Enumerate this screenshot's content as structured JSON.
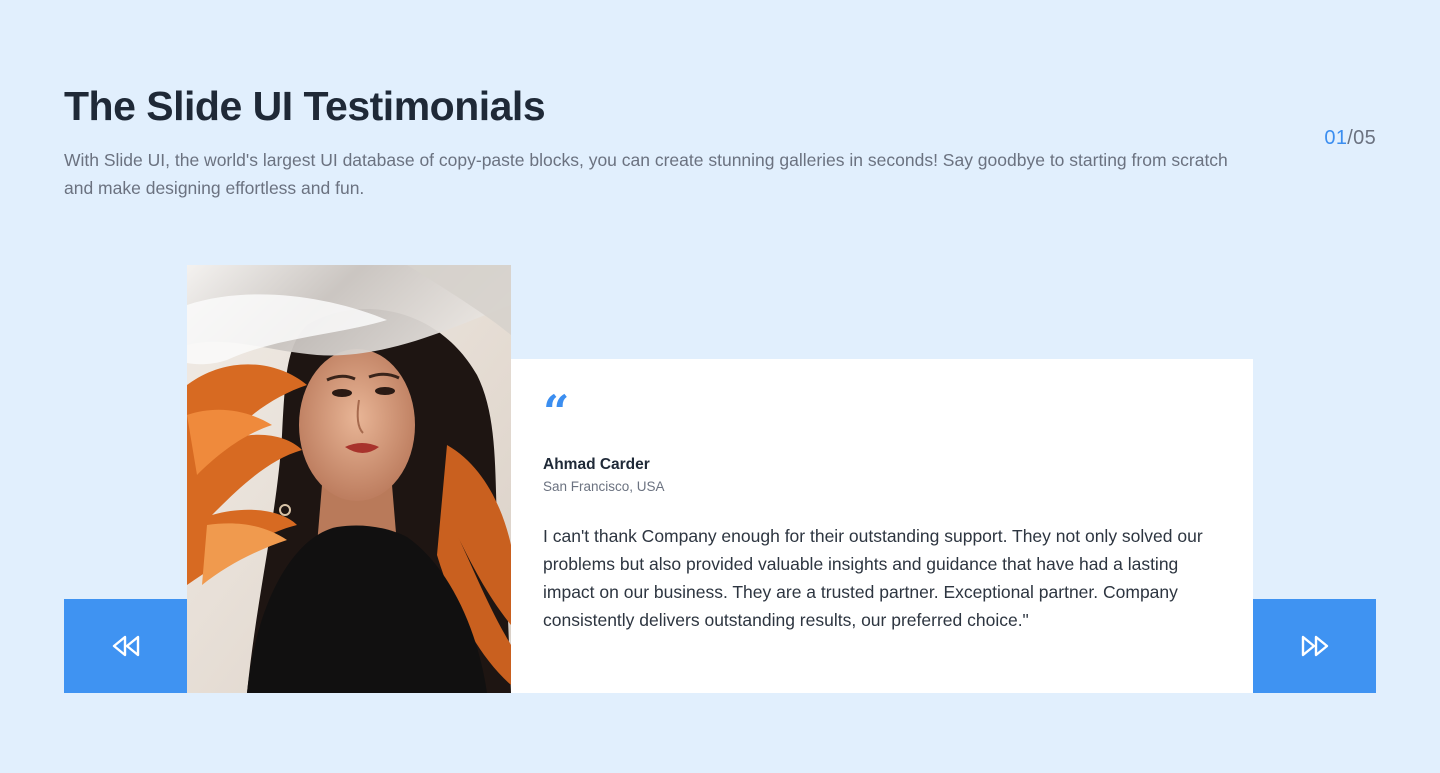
{
  "header": {
    "title": "The Slide UI Testimonials",
    "subtitle": "With Slide UI, the world's largest UI database of copy-paste blocks, you can create stunning galleries in seconds! Say goodbye to starting from scratch and make designing effortless and fun."
  },
  "pagination": {
    "current": "01",
    "separator": "/",
    "total": "05"
  },
  "testimonial": {
    "quote_icon": "quote-icon",
    "author_name": "Ahmad Carder",
    "author_location": "San Francisco, USA",
    "text": "I can't thank Company enough for their outstanding support. They not only solved our problems but also provided valuable insights and guidance that have had a lasting impact on our business. They are a trusted partner. Exceptional partner. Company consistently delivers outstanding results, our preferred choice.\""
  },
  "navigation": {
    "prev_icon": "rewind-icon",
    "next_icon": "fast-forward-icon"
  },
  "colors": {
    "background": "#e1effd",
    "accent": "#3f93f2",
    "heading": "#1f2937",
    "muted": "#6b7280"
  }
}
